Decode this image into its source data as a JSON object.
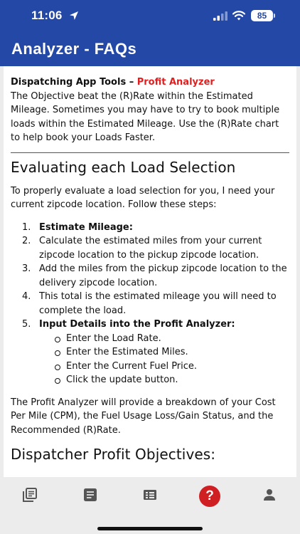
{
  "status_bar": {
    "time": "11:06",
    "battery": "85"
  },
  "header": {
    "title": "Analyzer - FAQs"
  },
  "intro": {
    "heading_prefix": "Dispatching App Tools – ",
    "heading_highlight": "Profit Analyzer",
    "text": "The Objective beat the (R)Rate within the Estimated Mileage. Sometimes you may have to try to book multiple loads within the Estimated Mileage. Use the (R)Rate chart to help book your Loads Faster."
  },
  "section1": {
    "title": "Evaluating each Load Selection",
    "lead": "To properly evaluate a load selection for you, I need your current zipcode location. Follow these steps:",
    "steps": [
      {
        "num": "1.",
        "text": "Estimate Mileage:"
      },
      {
        "num": "2.",
        "text": "Calculate the estimated miles from your current zipcode location to the pickup zipcode location."
      },
      {
        "num": "3.",
        "text": "Add the miles from the pickup zipcode location to the delivery zipcode location."
      },
      {
        "num": "4.",
        "text": "This total is the estimated mileage you will need to complete the load."
      },
      {
        "num": "5.",
        "text": "Input Details into the Profit Analyzer:"
      }
    ],
    "substeps": [
      "Enter the Load Rate.",
      "Enter the Estimated Miles.",
      "Enter the Current Fuel Price.",
      "Click the update button."
    ],
    "outro": "The Profit Analyzer will provide a breakdown of your Cost Per Mile (CPM), the Fuel Usage Loss/Gain Status, and the Recommended (R)Rate."
  },
  "section2": {
    "title": "Dispatcher Profit Objectives:"
  },
  "tabbar": {
    "icons": [
      "library-icon",
      "article-icon",
      "list-icon",
      "help-icon",
      "person-icon"
    ],
    "help_glyph": "?",
    "active_color": "#d01f22"
  },
  "colors": {
    "header_bg": "#2448a6",
    "highlight": "#e02020"
  }
}
